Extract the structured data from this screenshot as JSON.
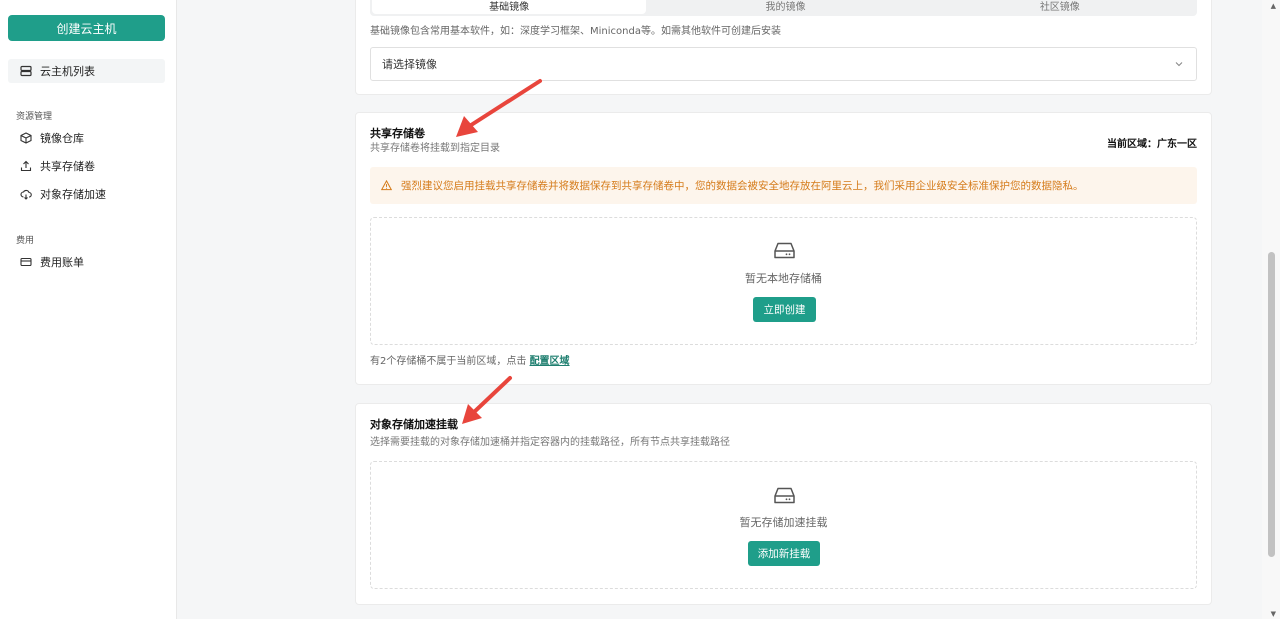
{
  "sidebar": {
    "create_button": "创建云主机",
    "items": [
      {
        "label": "云主机列表",
        "icon": "server-icon"
      },
      {
        "label": "镜像仓库",
        "icon": "cube-icon"
      },
      {
        "label": "共享存储卷",
        "icon": "upload-icon"
      },
      {
        "label": "对象存储加速",
        "icon": "cloud-icon"
      },
      {
        "label": "费用账单",
        "icon": "card-icon"
      }
    ],
    "groups": [
      "资源管理",
      "费用"
    ]
  },
  "image_section": {
    "tabs": [
      "基础镜像",
      "我的镜像",
      "社区镜像"
    ],
    "hint": "基础镜像包含常用基本软件，如：深度学习框架、Miniconda等。如需其他软件可创建后安装",
    "select_placeholder": "请选择镜像"
  },
  "shared_storage": {
    "title": "共享存储卷",
    "subtitle": "共享存储卷将挂载到指定目录",
    "region": "当前区域：广东一区",
    "warning": "强烈建议您启用挂载共享存储卷并将数据保存到共享存储卷中，您的数据会被安全地存放在阿里云上，我们采用企业级安全标准保护您的数据隐私。",
    "empty_text": "暂无本地存储桶",
    "create_button": "立即创建",
    "footnote": "有2个存储桶不属于当前区域，点击",
    "footnote_link": "配置区域"
  },
  "oss_accel": {
    "title": "对象存储加速挂载",
    "subtitle": "选择需要挂载的对象存储加速桶并指定容器内的挂载路径，所有节点共享挂载路径",
    "empty_text": "暂无存储加速挂载",
    "add_button": "添加新挂载"
  },
  "colors": {
    "accent": "#1f9e8a",
    "warning_text": "#d57b1a",
    "warning_bg": "#fdf5ec",
    "annotation_arrow": "#e8453c"
  }
}
